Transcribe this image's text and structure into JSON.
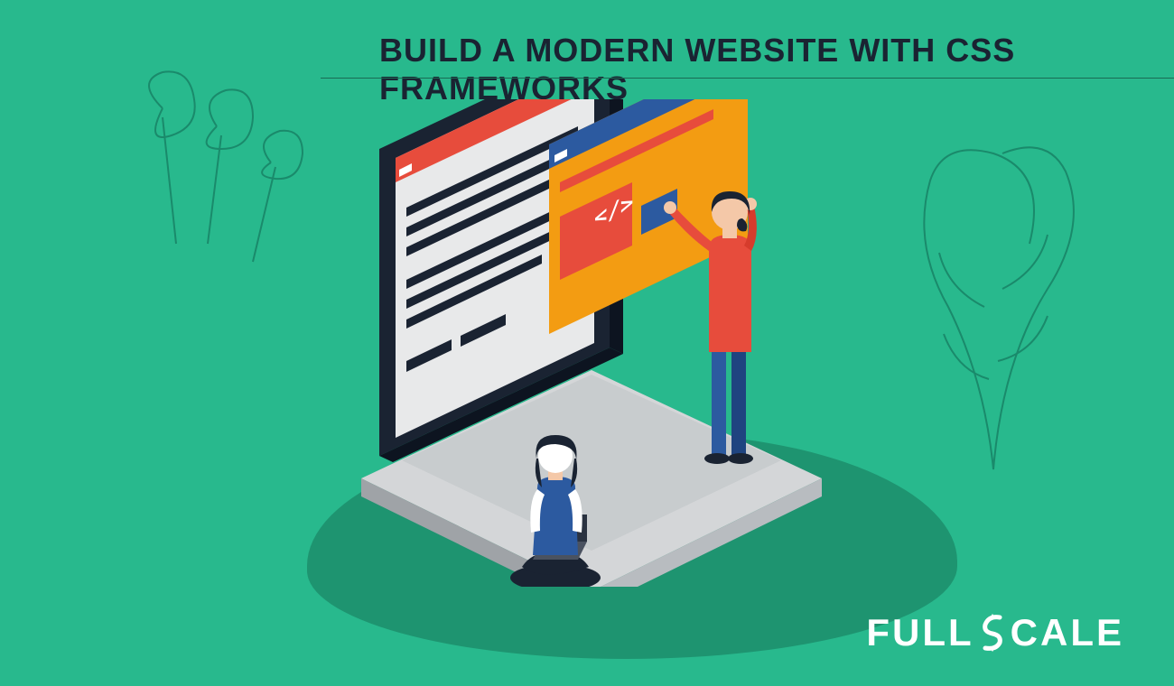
{
  "header": {
    "title": "BUILD A MODERN WEBSITE WITH CSS FRAMEWORKS"
  },
  "illustration": {
    "code_symbol": "</>",
    "elements": {
      "laptop": "isometric-laptop",
      "browser_window": "floating-browser-panel",
      "person_standing": "developer-standing",
      "person_sitting": "developer-sitting-laptop"
    }
  },
  "brand": {
    "logo_word1": "FULL",
    "logo_word2": "CALE",
    "logo_full": "FULL SCALE"
  },
  "colors": {
    "bg": "#28b98d",
    "shadow": "#1e9470",
    "dark": "#1a2332",
    "red": "#e74c3c",
    "orange": "#f39c12",
    "blue": "#2c5aa0",
    "white": "#ffffff",
    "grey": "#d4d6d8"
  }
}
